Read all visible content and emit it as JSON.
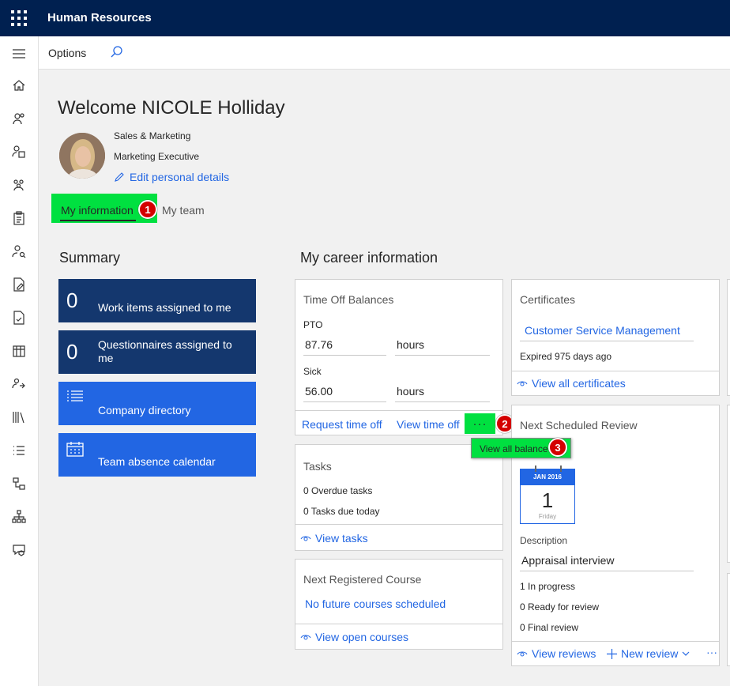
{
  "app": {
    "title": "Human Resources"
  },
  "actionbar": {
    "options_label": "Options"
  },
  "header": {
    "welcome": "Welcome NICOLE Holliday",
    "department": "Sales & Marketing",
    "job_title": "Marketing Executive",
    "edit_label": "Edit personal details"
  },
  "tabs": {
    "my_information": "My information",
    "my_team": "My team"
  },
  "badges": {
    "one": "1",
    "two": "2",
    "three": "3"
  },
  "summary": {
    "title": "Summary",
    "work_items": {
      "count": "0",
      "label": "Work items assigned to me"
    },
    "questionnaires": {
      "count": "0",
      "label": "Questionnaires assigned to me"
    },
    "company_directory": "Company directory",
    "team_absence": "Team absence calendar"
  },
  "career": {
    "title": "My career information",
    "timeoff": {
      "title": "Time Off Balances",
      "pto_label": "PTO",
      "pto_value": "87.76",
      "pto_unit": "hours",
      "sick_label": "Sick",
      "sick_value": "56.00",
      "sick_unit": "hours",
      "request": "Request time off",
      "view": "View time off",
      "more": "···",
      "view_all": "View all balance"
    },
    "tasks": {
      "title": "Tasks",
      "overdue": "0 Overdue tasks",
      "due_today": "0 Tasks due today",
      "view": "View tasks"
    },
    "course": {
      "title": "Next Registered Course",
      "none": "No future courses scheduled",
      "view": "View open courses"
    },
    "certificates": {
      "title": "Certificates",
      "item": "Customer Service Management",
      "expired": "Expired 975 days ago",
      "view_all": "View all certificates"
    },
    "review": {
      "title": "Next Scheduled Review",
      "cal_month": "JAN 2016",
      "cal_day": "1",
      "cal_weekday": "Friday",
      "desc_label": "Description",
      "desc_value": "Appraisal interview",
      "in_progress": "1 In progress",
      "ready": "0 Ready for review",
      "final": "0 Final review",
      "view": "View reviews",
      "new": "New review",
      "more": "···"
    }
  },
  "colors": {
    "topbar": "#002050",
    "accent": "#2266e3",
    "dark_tile": "#14376e",
    "highlight": "#00e040",
    "badge": "#d40000"
  }
}
